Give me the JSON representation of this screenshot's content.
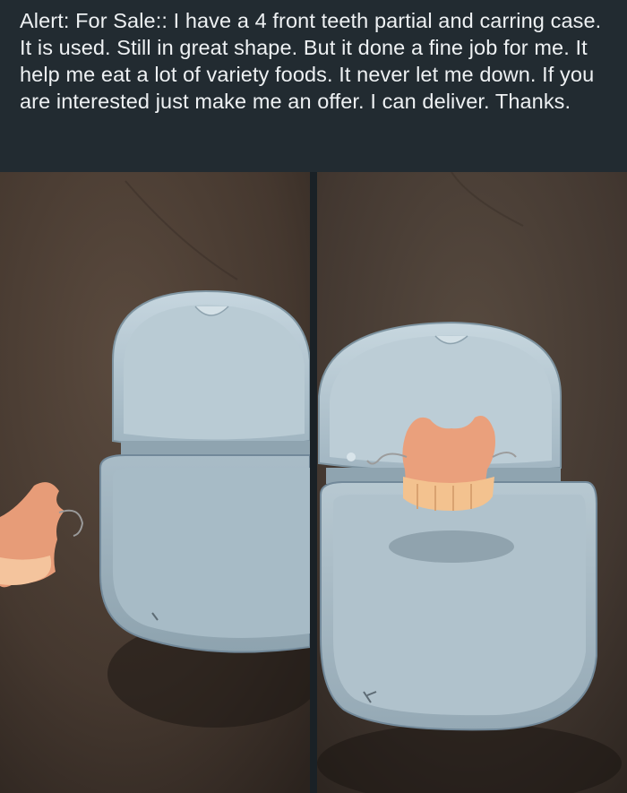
{
  "post": {
    "text": "Alert: For Sale:: I have a 4 front teeth partial and carring case. It is used. Still in great shape. But it done a fine job for me. It help me eat a lot of variety foods. It never let me down. If you are interested just make me an offer. I can deliver. Thanks."
  },
  "photos": [
    {
      "subject": "open-denture-case-with-partial-beside"
    },
    {
      "subject": "open-denture-case-with-partial-inside"
    }
  ],
  "colors": {
    "background": "#222b31",
    "text": "#eef1f3",
    "floor": "#4a3d33",
    "case": "#b3c6d0",
    "partial": "#e8a37f"
  }
}
